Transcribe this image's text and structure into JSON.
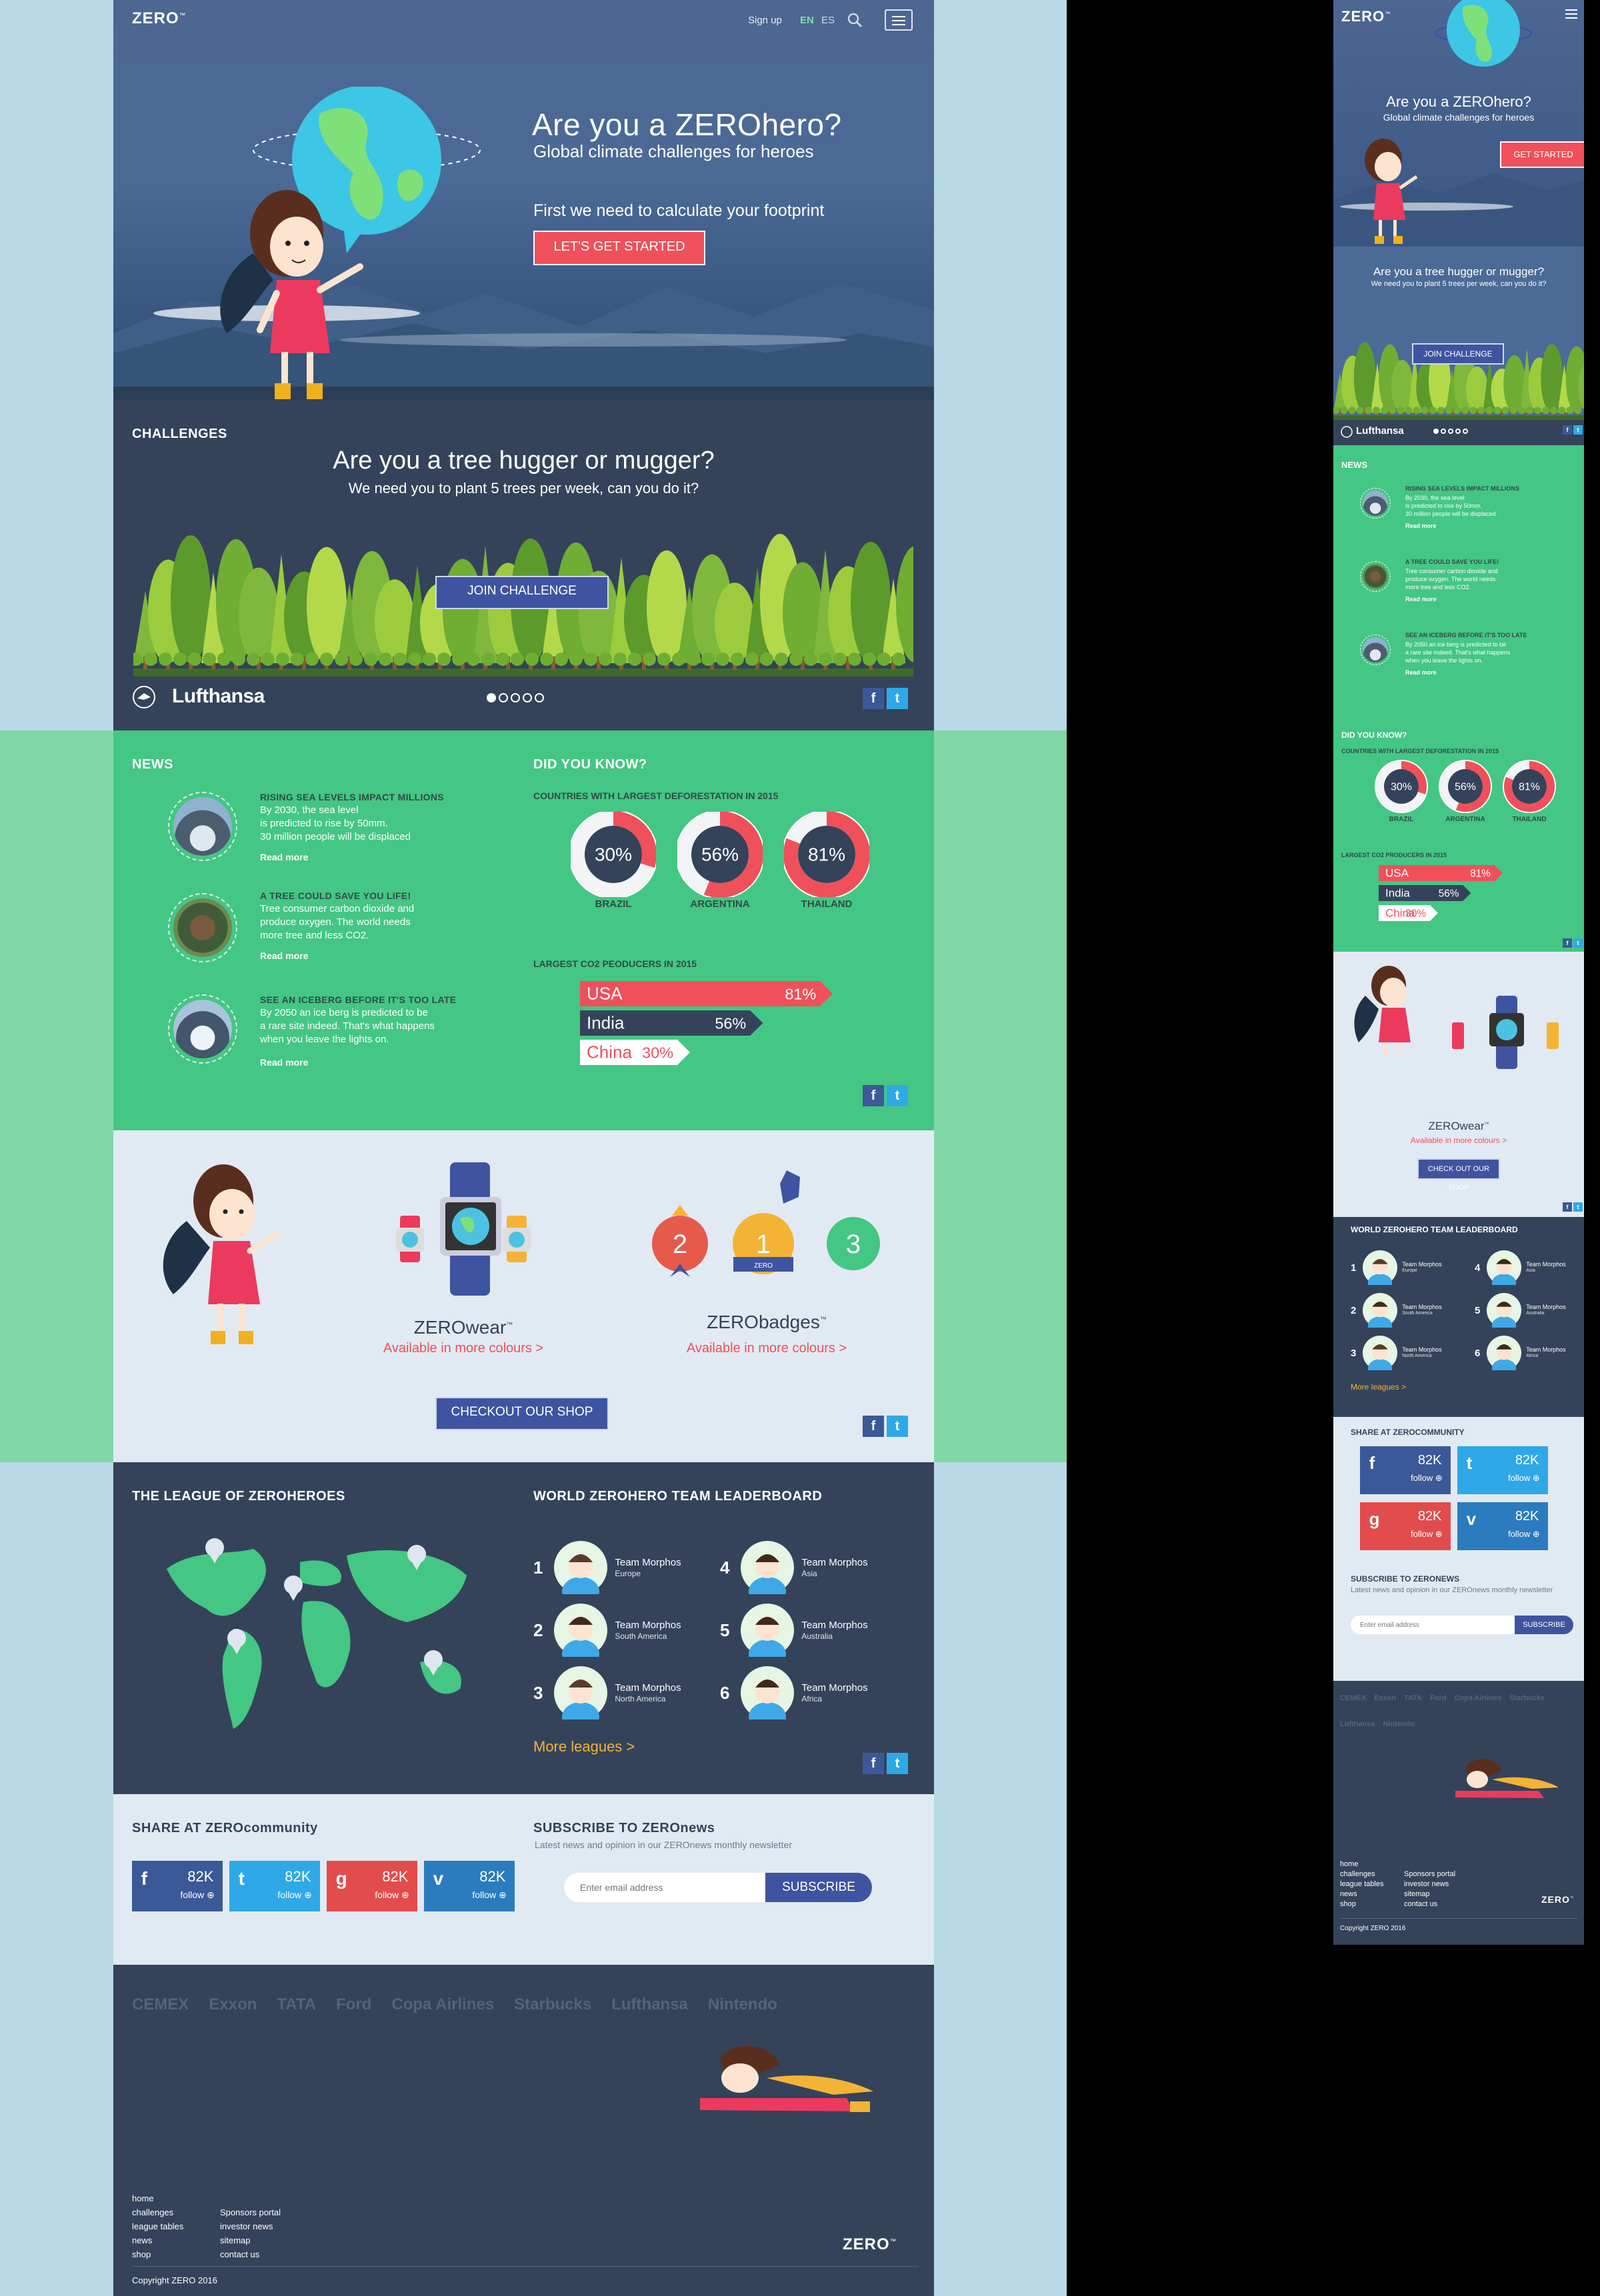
{
  "brand": {
    "logo": "ZERO",
    "tm": "™"
  },
  "colors": {
    "navy": "#34435a",
    "green": "#44c684",
    "red": "#f0505a",
    "blue": "#3f54a1",
    "light": "#e1eaf2",
    "orange": "#f5b335"
  },
  "nav": {
    "signup": "Sign up",
    "lang_en": "EN",
    "lang_es": "ES",
    "search_icon": "search-icon",
    "menu_icon": "hamburger-icon"
  },
  "hero": {
    "title": "Are you a ZEROhero?",
    "subtitle": "Global climate challenges for heroes",
    "footprint": "First we need to calculate your footprint",
    "cta": "LET'S GET STARTED",
    "mobile_cta": "GET STARTED"
  },
  "challenges": {
    "label": "CHALLENGES",
    "title": "Are you a tree hugger or mugger?",
    "subtitle": "We need you to plant 5 trees per week, can you do it?",
    "cta": "JOIN CHALLENGE",
    "sponsor": "Lufthansa",
    "slides": 5,
    "active_slide": 1
  },
  "news": {
    "label": "NEWS",
    "items": [
      {
        "title": "RISING SEA LEVELS IMPACT MILLIONS",
        "lines": [
          "By 2030, the sea level",
          "is predicted to rise by 50mm.",
          "30 million people will be displaced"
        ],
        "more": "Read more"
      },
      {
        "title": "A TREE COULD SAVE YOU LIFE!",
        "lines": [
          "Tree consumer carbon dioxide and",
          "produce oxygen. The world needs",
          "more tree and less CO2."
        ],
        "more": "Read more"
      },
      {
        "title": "SEE AN ICEBERG BEFORE IT'S TOO LATE",
        "lines": [
          "By 2050 an ice berg is predicted to be",
          "a rare site indeed. That's what happens",
          "when you leave the lights on."
        ],
        "more": "Read more"
      }
    ]
  },
  "did_you_know": {
    "label": "DID YOU KNOW?",
    "deforestation_title": "COUNTRIES WITH LARGEST DEFORESTATION IN 2015",
    "co2_title": "LARGEST CO2 PEODUCERS IN 2015",
    "co2_title_mobile": "LARGEST CO2 PRODUCERS IN 2015"
  },
  "chart_data": [
    {
      "type": "pie",
      "title": "COUNTRIES WITH LARGEST DEFORESTATION IN 2015",
      "categories": [
        "BRAZIL",
        "ARGENTINA",
        "THAILAND"
      ],
      "values": [
        30,
        56,
        81
      ],
      "unit": "%"
    },
    {
      "type": "bar",
      "title": "LARGEST CO2 PEODUCERS IN 2015",
      "categories": [
        "USA",
        "India",
        "China"
      ],
      "values": [
        81,
        56,
        30
      ],
      "unit": "%"
    }
  ],
  "shop": {
    "wear_title": "ZEROwear",
    "wear_link": "Available in more colours >",
    "badges_title": "ZERObadges",
    "badges_link": "Available in more colours >",
    "cta": "CHECKOUT OUR SHOP",
    "mobile_cta": "CHECK OUT OUR SHOP",
    "badge_numbers": [
      "2",
      "1",
      "3"
    ],
    "badge_zero": "ZERO"
  },
  "league": {
    "map_title": "THE LEAGUE OF ZEROHEROES",
    "board_title": "WORLD ZEROHERO TEAM LEADERBOARD",
    "teams": [
      {
        "rank": "1",
        "name": "Team Morphos",
        "region": "Europe"
      },
      {
        "rank": "2",
        "name": "Team Morphos",
        "region": "South America"
      },
      {
        "rank": "3",
        "name": "Team Morphos",
        "region": "North America"
      },
      {
        "rank": "4",
        "name": "Team Morphos",
        "region": "Asia"
      },
      {
        "rank": "5",
        "name": "Team Morphos",
        "region": "Australia"
      },
      {
        "rank": "6",
        "name": "Team Morphos",
        "region": "Africa"
      }
    ],
    "more": "More leagues >"
  },
  "share": {
    "title": "SHARE AT ZEROcommunity",
    "mobile_title": "SHARE AT ZEROCOMMUNITY",
    "networks": [
      {
        "icon": "f",
        "count": "82K",
        "follow": "follow",
        "color": "#3b5998"
      },
      {
        "icon": "t",
        "count": "82K",
        "follow": "follow",
        "color": "#2fa8e8"
      },
      {
        "icon": "g",
        "count": "82K",
        "follow": "follow",
        "color": "#e24c4c"
      },
      {
        "icon": "v",
        "count": "82K",
        "follow": "follow",
        "color": "#2b7bbf"
      }
    ]
  },
  "subscribe": {
    "title": "SUBSCRIBE TO ZEROnews",
    "mobile_title": "SUBSCRIBE TO ZERONEWS",
    "text": "Latest news and opinion in our ZEROnews monthly newsletter",
    "placeholder": "Enter email address",
    "button": "SUBSCRIBE"
  },
  "sponsors": [
    "CEMEX",
    "Exxon",
    "TATA",
    "Ford",
    "Copa Airlines",
    "Starbucks",
    "Lufthansa",
    "Nintendo"
  ],
  "footer": {
    "col1": [
      "home",
      "challenges",
      "league tables",
      "news",
      "shop"
    ],
    "col2": [
      "Sponsors portal",
      "investor news",
      "sitemap",
      "contact us"
    ],
    "copyright": "Copyright ZERO 2016"
  }
}
